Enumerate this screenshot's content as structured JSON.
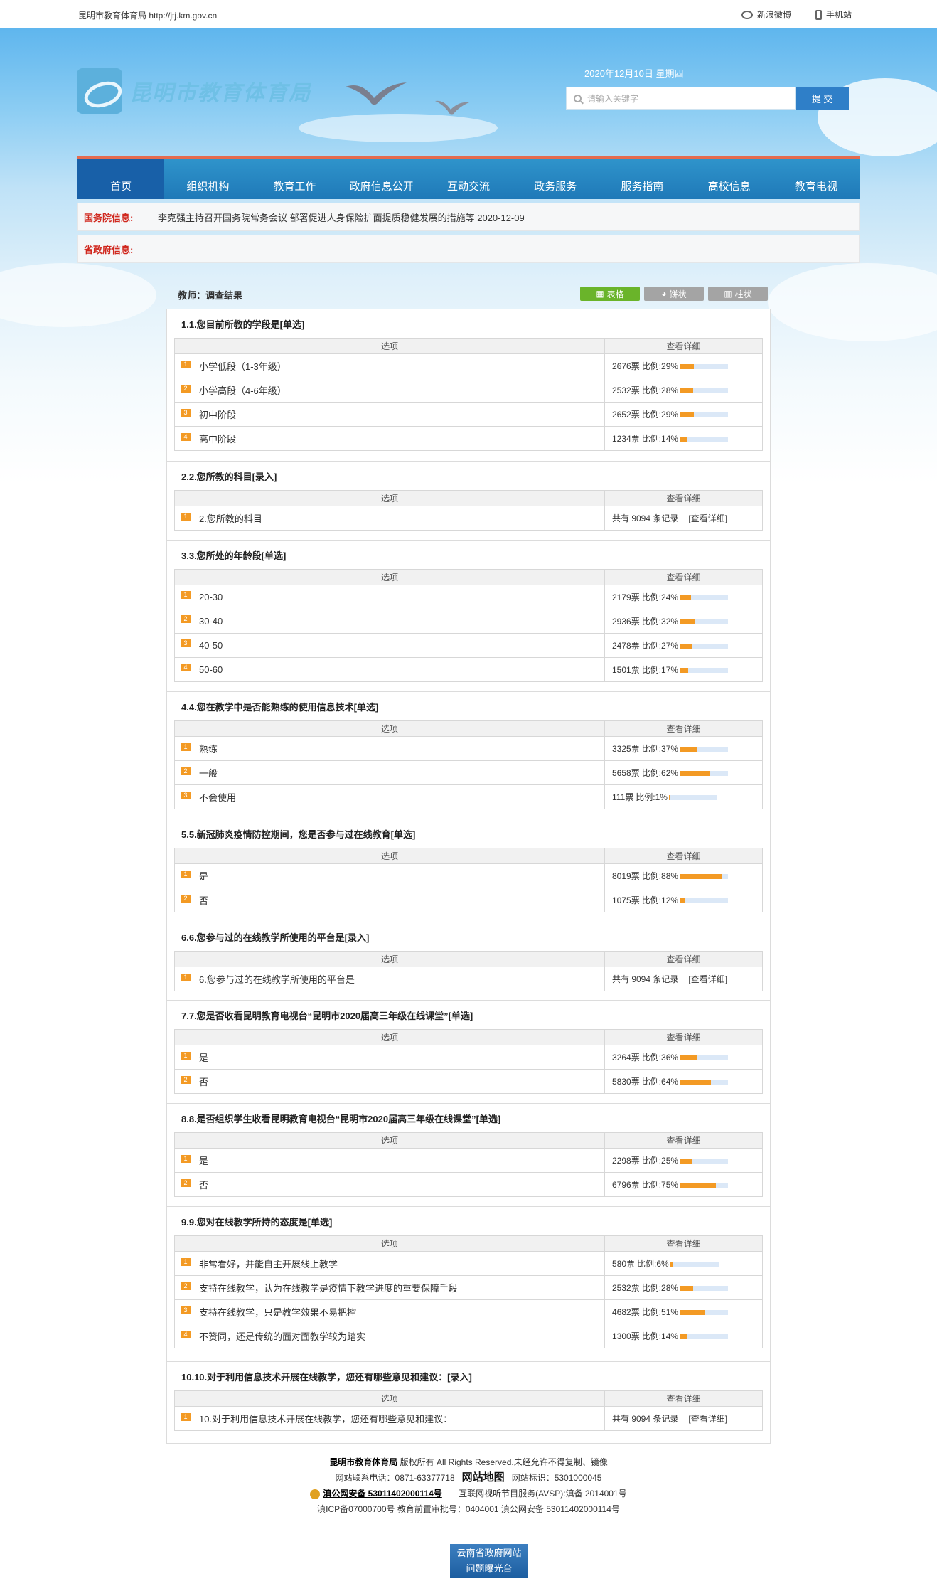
{
  "topbar": {
    "site": "昆明市教育体育局 http://jtj.km.gov.cn",
    "weibo": "新浪微博",
    "mobile": "手机站"
  },
  "header": {
    "logo_text": "昆明市教育体育局",
    "date": "2020年12月10日 星期四",
    "search_placeholder": "请输入关键字",
    "search_button": "提 交"
  },
  "nav": [
    "首页",
    "组织机构",
    "教育工作",
    "政府信息公开",
    "互动交流",
    "政务服务",
    "服务指南",
    "高校信息",
    "教育电视"
  ],
  "notices": [
    {
      "label": "国务院信息:",
      "text": "李克强主持召开国务院常务会议 部署促进人身保险扩面提质稳健发展的措施等 2020-12-09"
    },
    {
      "label": "省政府信息:",
      "text": ""
    }
  ],
  "survey": {
    "title": "教师：调查结果",
    "views": [
      "表格",
      "饼状",
      "柱状"
    ],
    "col_option": "选项",
    "col_detail": "查看详细"
  },
  "questions": [
    {
      "title": "1.1.您目前所教的学段是[单选]",
      "type": "choice",
      "options": [
        {
          "label": "小学低段（1-3年级）",
          "votes": "2676票",
          "ratio": "比例:29%",
          "pct": 29
        },
        {
          "label": "小学高段（4-6年级）",
          "votes": "2532票",
          "ratio": "比例:28%",
          "pct": 28
        },
        {
          "label": "初中阶段",
          "votes": "2652票",
          "ratio": "比例:29%",
          "pct": 29
        },
        {
          "label": "高中阶段",
          "votes": "1234票",
          "ratio": "比例:14%",
          "pct": 14
        }
      ]
    },
    {
      "title": "2.2.您所教的科目[录入]",
      "type": "text",
      "options": [
        {
          "label": "2.您所教的科目",
          "records": "共有 9094 条记录",
          "link": "[查看详细]"
        }
      ]
    },
    {
      "title": "3.3.您所处的年龄段[单选]",
      "type": "choice",
      "options": [
        {
          "label": "20-30",
          "votes": "2179票",
          "ratio": "比例:24%",
          "pct": 24
        },
        {
          "label": "30-40",
          "votes": "2936票",
          "ratio": "比例:32%",
          "pct": 32
        },
        {
          "label": "40-50",
          "votes": "2478票",
          "ratio": "比例:27%",
          "pct": 27
        },
        {
          "label": "50-60",
          "votes": "1501票",
          "ratio": "比例:17%",
          "pct": 17
        }
      ]
    },
    {
      "title": "4.4.您在教学中是否能熟练的使用信息技术[单选]",
      "type": "choice",
      "options": [
        {
          "label": "熟练",
          "votes": "3325票",
          "ratio": "比例:37%",
          "pct": 37
        },
        {
          "label": "一般",
          "votes": "5658票",
          "ratio": "比例:62%",
          "pct": 62
        },
        {
          "label": "不会使用",
          "votes": "111票",
          "ratio": "比例:1%",
          "pct": 1
        }
      ]
    },
    {
      "title": "5.5.新冠肺炎疫情防控期间，您是否参与过在线教育[单选]",
      "type": "choice",
      "options": [
        {
          "label": "是",
          "votes": "8019票",
          "ratio": "比例:88%",
          "pct": 88
        },
        {
          "label": "否",
          "votes": "1075票",
          "ratio": "比例:12%",
          "pct": 12
        }
      ]
    },
    {
      "title": "6.6.您参与过的在线教学所使用的平台是[录入]",
      "type": "text",
      "options": [
        {
          "label": "6.您参与过的在线教学所使用的平台是",
          "records": "共有 9094 条记录",
          "link": "[查看详细]"
        }
      ]
    },
    {
      "title": "7.7.您是否收看昆明教育电视台“昆明市2020届高三年级在线课堂”[单选]",
      "type": "choice",
      "options": [
        {
          "label": "是",
          "votes": "3264票",
          "ratio": "比例:36%",
          "pct": 36
        },
        {
          "label": "否",
          "votes": "5830票",
          "ratio": "比例:64%",
          "pct": 64
        }
      ]
    },
    {
      "title": "8.8.是否组织学生收看昆明教育电视台“昆明市2020届高三年级在线课堂”[单选]",
      "type": "choice",
      "options": [
        {
          "label": "是",
          "votes": "2298票",
          "ratio": "比例:25%",
          "pct": 25
        },
        {
          "label": "否",
          "votes": "6796票",
          "ratio": "比例:75%",
          "pct": 75
        }
      ]
    },
    {
      "title": "9.9.您对在线教学所持的态度是[单选]",
      "type": "choice",
      "options": [
        {
          "label": "非常看好，并能自主开展线上教学",
          "votes": "580票",
          "ratio": "比例:6%",
          "pct": 6
        },
        {
          "label": "支持在线教学，认为在线教学是疫情下教学进度的重要保障手段",
          "votes": "2532票",
          "ratio": "比例:28%",
          "pct": 28
        },
        {
          "label": "支持在线教学，只是教学效果不易把控",
          "votes": "4682票",
          "ratio": "比例:51%",
          "pct": 51
        },
        {
          "label": "不赞同，还是传统的面对面教学较为踏实",
          "votes": "1300票",
          "ratio": "比例:14%",
          "pct": 14
        }
      ]
    },
    {
      "title": "10.10.对于利用信息技术开展在线教学，您还有哪些意见和建议：[录入]",
      "type": "text",
      "options": [
        {
          "label": "10.对于利用信息技术开展在线教学，您还有哪些意见和建议：",
          "records": "共有 9094 条记录",
          "link": "[查看详细]"
        }
      ]
    }
  ],
  "footer": {
    "owner": "昆明市教育体育局",
    "rights": "版权所有 All Rights Reserved.未经允许不得复制、镜像",
    "phone_label": "网站联系电话：",
    "phone": "0871-63377718",
    "sitemap": "网站地图",
    "site_id_label": "网站标识：",
    "site_id": "5301000045",
    "police_record": "滇公网安备 53011402000114号",
    "avsp": "互联网视听节目服务(AVSP):滇备 2014001号",
    "icp": "滇ICP备07000700号 教育前置审批号：0404001 滇公网安备 53011402000114号",
    "badge_line1": "云南省政府网站",
    "badge_line2": "问题曝光台"
  }
}
